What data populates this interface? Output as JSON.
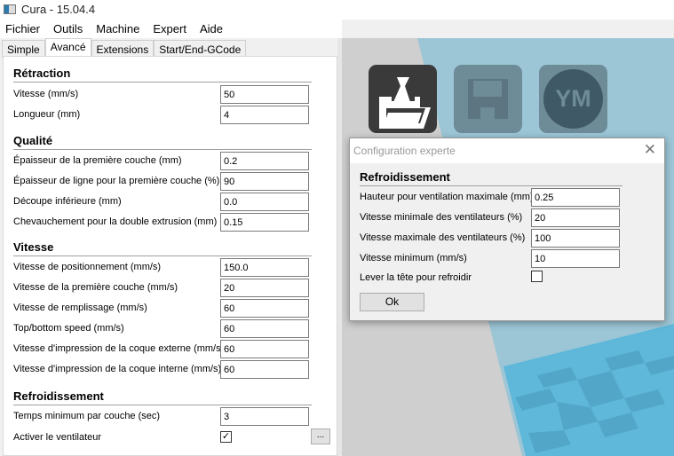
{
  "window": {
    "title": "Cura - 15.04.4"
  },
  "menu": [
    "Fichier",
    "Outils",
    "Machine",
    "Expert",
    "Aide"
  ],
  "tabs": [
    "Simple",
    "Avancé",
    "Extensions",
    "Start/End-GCode"
  ],
  "sections": {
    "retraction": {
      "title": "Rétraction",
      "rows": [
        {
          "label": "Vitesse (mm/s)",
          "value": "50"
        },
        {
          "label": "Longueur (mm)",
          "value": "4"
        }
      ]
    },
    "qualite": {
      "title": "Qualité",
      "rows": [
        {
          "label": "Épaisseur de la première couche (mm)",
          "value": "0.2"
        },
        {
          "label": "Épaisseur de ligne pour la première couche (%)",
          "value": "90"
        },
        {
          "label": "Découpe inférieure (mm)",
          "value": "0.0"
        },
        {
          "label": "Chevauchement pour la double extrusion (mm)",
          "value": "0.15"
        }
      ]
    },
    "vitesse": {
      "title": "Vitesse",
      "rows": [
        {
          "label": "Vitesse de positionnement (mm/s)",
          "value": "150.0"
        },
        {
          "label": "Vitesse de la première couche (mm/s)",
          "value": "20"
        },
        {
          "label": "Vitesse de remplissage (mm/s)",
          "value": "60"
        },
        {
          "label": "Top/bottom speed (mm/s)",
          "value": "60"
        },
        {
          "label": "Vitesse d'impression de la coque externe (mm/s)",
          "value": "60"
        },
        {
          "label": "Vitesse d'impression de la coque interne (mm/s)",
          "value": "60"
        }
      ]
    },
    "refroidissement": {
      "title": "Refroidissement",
      "rows": [
        {
          "label": "Temps minimum par couche (sec)",
          "value": "3"
        }
      ],
      "fan_label": "Activer le ventilateur",
      "fan_checked": true,
      "more_button": "..."
    }
  },
  "viewport": {
    "logo_text": "YM"
  },
  "dialog": {
    "title": "Configuration experte",
    "section": "Refroidissement",
    "rows": [
      {
        "label": "Hauteur pour ventilation maximale (mm)",
        "value": "0.25"
      },
      {
        "label": "Vitesse minimale des ventilateurs (%)",
        "value": "20"
      },
      {
        "label": "Vitesse maximale des ventilateurs (%)",
        "value": "100"
      },
      {
        "label": "Vitesse minimum (mm/s)",
        "value": "10"
      }
    ],
    "lift_label": "Lever la tête pour refroidir",
    "lift_checked": false,
    "ok": "Ok"
  }
}
